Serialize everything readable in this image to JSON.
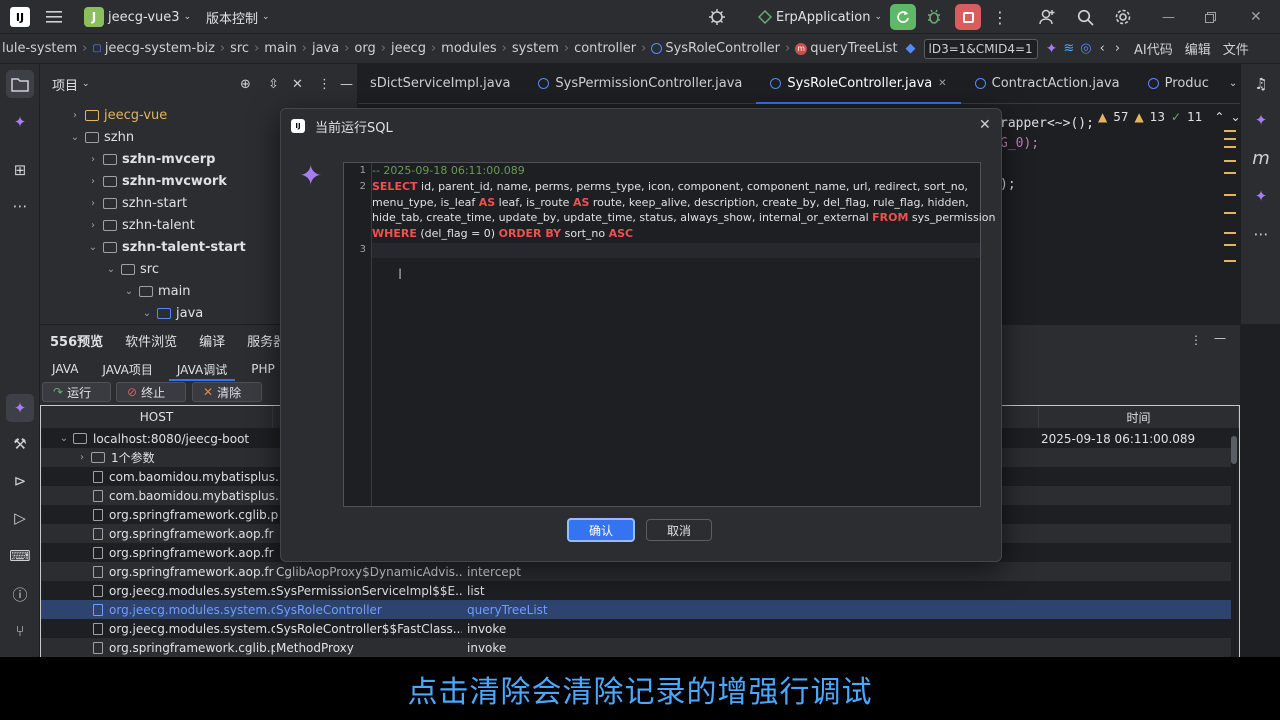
{
  "titlebar": {
    "logo_text": "IJ",
    "project_badge": "J",
    "project_name": "jeecg-vue3",
    "vcs_label": "版本控制",
    "run_config": "ErpApplication",
    "colors": {
      "run_green": "#5fb865",
      "stop_red": "#db5c5c"
    }
  },
  "breadcrumb": {
    "items": [
      "lule-system",
      "jeecg-system-biz",
      "src",
      "main",
      "java",
      "org",
      "jeecg",
      "modules",
      "system",
      "controller",
      "SysRoleController",
      "queryTreeList"
    ],
    "search_value": "lD3=1&CMID4=1",
    "ai_label": "AI代码",
    "edit_label": "编辑",
    "file_label": "文件"
  },
  "project_panel": {
    "title": "项目",
    "tree": [
      {
        "label": "jeecg-vue",
        "bold": false,
        "color": "#e5b45b"
      },
      {
        "label": "szhn",
        "bold": false
      },
      {
        "label": "szhn-mvcerp",
        "bold": true
      },
      {
        "label": "szhn-mvcwork",
        "bold": true
      },
      {
        "label": "szhn-start",
        "bold": false
      },
      {
        "label": "szhn-talent",
        "bold": false
      },
      {
        "label": "szhn-talent-start",
        "bold": true
      },
      {
        "label": "src",
        "bold": false
      },
      {
        "label": "main",
        "bold": false
      },
      {
        "label": "java",
        "bold": false
      }
    ]
  },
  "editor": {
    "tabs": [
      {
        "label": "sDictServiceImpl.java",
        "active": false
      },
      {
        "label": "SysPermissionController.java",
        "active": false
      },
      {
        "label": "SysRoleController.java",
        "active": true
      },
      {
        "label": "ContractAction.java",
        "active": false
      },
      {
        "label": "Produc",
        "active": false
      }
    ],
    "code_fragments": [
      "rapper<~>();",
      "G_0);",
      ");"
    ],
    "inspections": {
      "warnings": "57",
      "weak": "13",
      "ok": "11"
    }
  },
  "bottom": {
    "tabs": [
      "556预览",
      "软件浏览",
      "编译",
      "服务器"
    ],
    "subtabs": [
      {
        "label": "JAVA",
        "active": false
      },
      {
        "label": "JAVA项目",
        "active": false
      },
      {
        "label": "JAVA调试",
        "active": true
      },
      {
        "label": "PHP",
        "active": false
      }
    ],
    "buttons": {
      "run": "运行",
      "stop": "终止",
      "clear": "清除"
    },
    "columns": {
      "host": "HOST",
      "time": "时间"
    },
    "rows": [
      {
        "indent": 1,
        "kind": "folder",
        "col1": "localhost:8080/jeecg-boot",
        "col2": "",
        "col3": "",
        "time": "2025-09-18 06:11:00.089"
      },
      {
        "indent": 2,
        "kind": "folder",
        "col1": "1个参数",
        "col2": "",
        "col3": "",
        "time": ""
      },
      {
        "indent": 3,
        "kind": "file",
        "col1": "com.baomidou.mybatisplus.",
        "col2": "",
        "col3": "",
        "time": ""
      },
      {
        "indent": 3,
        "kind": "file",
        "col1": "com.baomidou.mybatisplus.",
        "col2": "",
        "col3": "",
        "time": ""
      },
      {
        "indent": 3,
        "kind": "file",
        "col1": "org.springframework.cglib.p",
        "col2": "",
        "col3": "",
        "time": ""
      },
      {
        "indent": 3,
        "kind": "file",
        "col1": "org.springframework.aop.fr",
        "col2": "",
        "col3": "",
        "time": ""
      },
      {
        "indent": 3,
        "kind": "file",
        "col1": "org.springframework.aop.fr",
        "col2": "",
        "col3": "",
        "time": ""
      },
      {
        "indent": 3,
        "kind": "file",
        "col1": "org.springframework.aop.fr",
        "col2": "CglibAopProxy$DynamicAdvis...",
        "col3": "intercept",
        "time": ""
      },
      {
        "indent": 3,
        "kind": "file",
        "col1": "org.jeecg.modules.system.s",
        "col2": "SysPermissionServiceImpl$$E...",
        "col3": "list",
        "time": ""
      },
      {
        "indent": 3,
        "kind": "file",
        "col1": "org.jeecg.modules.system.c",
        "col2": "SysRoleController",
        "col3": "queryTreeList",
        "time": "",
        "selected": true
      },
      {
        "indent": 3,
        "kind": "file",
        "col1": "org.jeecg.modules.system.c",
        "col2": "SysRoleController$$FastClass...",
        "col3": "invoke",
        "time": ""
      },
      {
        "indent": 3,
        "kind": "file",
        "col1": "org.springframework.cglib.p",
        "col2": "MethodProxy",
        "col3": "invoke",
        "time": ""
      }
    ]
  },
  "dialog": {
    "title": "当前运行SQL",
    "line_numbers": [
      "1",
      "2",
      "3"
    ],
    "comment": "-- 2025-09-18 06:11:00.089",
    "sql_lines": [
      [
        {
          "k": true,
          "t": "SELECT"
        },
        {
          "k": false,
          "t": " id, parent_id, name, perms, perms_type, icon, component, component_name, url, redirect, sort_no,"
        }
      ],
      [
        {
          "k": false,
          "t": "menu_type, is_leaf "
        },
        {
          "k": true,
          "t": "AS"
        },
        {
          "k": false,
          "t": " leaf, is_route "
        },
        {
          "k": true,
          "t": "AS"
        },
        {
          "k": false,
          "t": " route, keep_alive, description, create_by, del_flag, rule_flag, hidden,"
        }
      ],
      [
        {
          "k": false,
          "t": "hide_tab, create_time, update_by, update_time, status, always_show, internal_or_external "
        },
        {
          "k": true,
          "t": "FROM"
        },
        {
          "k": false,
          "t": " sys_permission"
        }
      ],
      [
        {
          "k": true,
          "t": "WHERE"
        },
        {
          "k": false,
          "t": " (del_flag = 0) "
        },
        {
          "k": true,
          "t": "ORDER BY"
        },
        {
          "k": false,
          "t": " sort_no "
        },
        {
          "k": true,
          "t": "ASC"
        }
      ]
    ],
    "confirm": "确认",
    "cancel": "取消",
    "colors": {
      "keyword": "#f0504f",
      "comment": "#6a9955",
      "primary": "#3574f0"
    }
  },
  "caption": "点击清除会清除记录的增强行调试"
}
